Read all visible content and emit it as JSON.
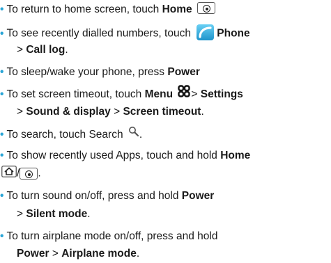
{
  "bullet": "•",
  "accent_color": "#2aa5d6",
  "items": [
    {
      "pre": "To return to home screen, touch ",
      "b1": "Home",
      "icon": "home-button-icon"
    },
    {
      "pre": "To see recently dialled numbers, touch ",
      "icon": "phone-app-icon",
      "b1": "Phone",
      "cont_pre": "> ",
      "cont_b": "Call log",
      "cont_post": "."
    },
    {
      "pre": "To sleep/wake your phone, press ",
      "b1": "Power"
    },
    {
      "pre": "To set screen timeout, touch ",
      "b1": "Menu",
      "icon": "menu-icon",
      "mid": "> ",
      "b2": "Settings",
      "cont_pre": "> ",
      "cont_b": "Sound & display",
      "cont_mid": " > ",
      "cont_b2": "Screen timeout",
      "cont_post": "."
    },
    {
      "pre": "To search, touch Search ",
      "icon": "search-icon",
      "post": "."
    },
    {
      "pre": "To show recently used Apps, touch and hold ",
      "b1": "Home",
      "cont_icons": [
        "home-house-icon",
        "home-button-icon"
      ],
      "cont_sep": "/",
      "cont_post": "."
    },
    {
      "pre": "To turn sound on/off, press and hold ",
      "b1": "Power",
      "cont_pre": "> ",
      "cont_b": "Silent mode",
      "cont_post": "."
    },
    {
      "pre": "To turn airplane mode on/off, press and hold",
      "cont_b": "Power",
      "cont_mid": " > ",
      "cont_b2": "Airplane mode",
      "cont_post": "."
    }
  ]
}
